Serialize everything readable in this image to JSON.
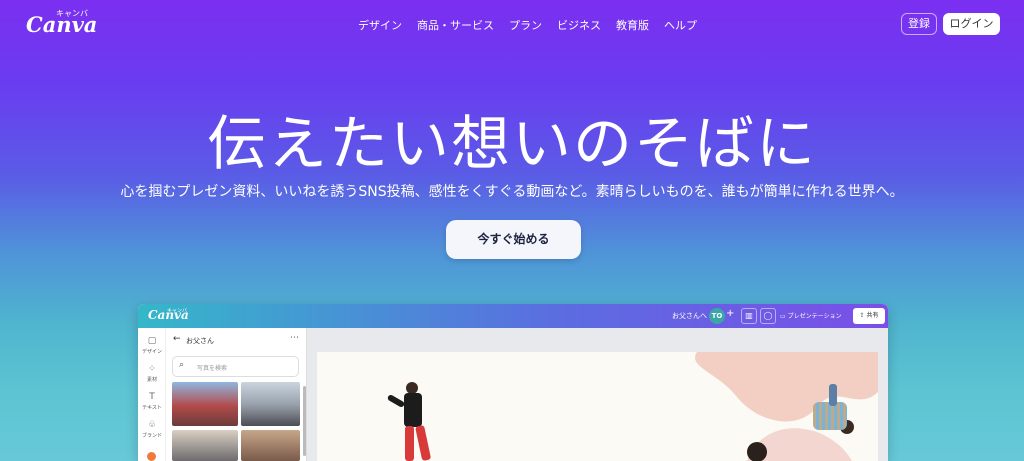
{
  "nav": {
    "logo": "Canva",
    "logo_kana": "キャンバ",
    "links": [
      "デザイン",
      "商品・サービス",
      "プラン",
      "ビジネス",
      "教育版",
      "ヘルプ"
    ],
    "signup_label": "登録",
    "login_label": "ログイン"
  },
  "hero": {
    "title": "伝えたい想いのそばに",
    "subtitle": "心を掴むプレゼン資料、いいねを誘うSNS投稿、感性をくすぐる動画など。素晴らしいものを、誰もが簡単に作れる世界へ。",
    "cta_label": "今すぐ始める"
  },
  "app": {
    "logo": "Canva",
    "logo_kana": "キャンバ",
    "doc_name": "お父さんへ",
    "avatar": "TO",
    "plus": "+",
    "present_label": "プレゼンテーション",
    "share_label": "共有",
    "rail": [
      "デザイン",
      "素材",
      "テキスト",
      "ブランド"
    ],
    "panel_title": "お父さん",
    "search_placeholder": "写真を検索"
  },
  "colors": {
    "accent": "#7b2ff0",
    "teal": "#5cc4d2",
    "cta_text": "#1c2340"
  }
}
